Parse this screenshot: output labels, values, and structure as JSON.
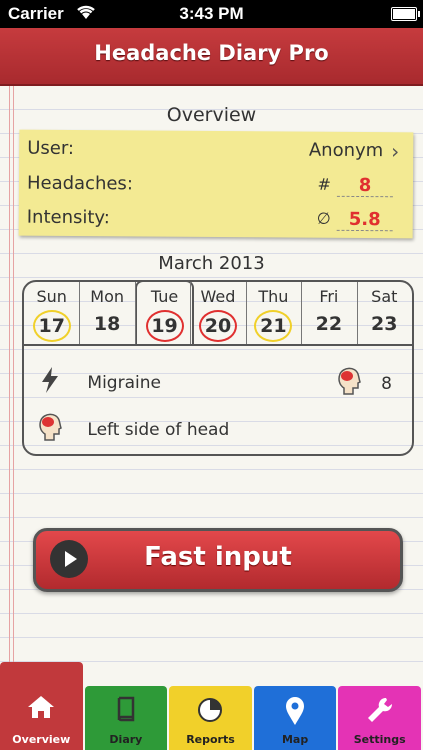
{
  "status_bar": {
    "carrier": "Carrier",
    "time": "3:43 PM"
  },
  "header": {
    "title": "Headache Diary Pro"
  },
  "overview": {
    "title": "Overview",
    "user_label": "User:",
    "user_value": "Anonym",
    "headaches_label": "Headaches:",
    "headaches_symbol": "#",
    "headaches_value": "8",
    "intensity_label": "Intensity:",
    "intensity_symbol": "∅",
    "intensity_value": "5.8"
  },
  "calendar": {
    "month": "March 2013",
    "days": [
      {
        "name": "Sun",
        "date": "17",
        "mark": "yellow"
      },
      {
        "name": "Mon",
        "date": "18",
        "mark": "none"
      },
      {
        "name": "Tue",
        "date": "19",
        "mark": "red",
        "selected": true
      },
      {
        "name": "Wed",
        "date": "20",
        "mark": "red"
      },
      {
        "name": "Thu",
        "date": "21",
        "mark": "yellow"
      },
      {
        "name": "Fri",
        "date": "22",
        "mark": "none"
      },
      {
        "name": "Sat",
        "date": "23",
        "mark": "none"
      }
    ],
    "event_type": "Migraine",
    "event_count": "8",
    "event_location": "Left side of head"
  },
  "fast_input": {
    "label": "Fast input"
  },
  "tabs": [
    {
      "label": "Overview",
      "icon": "home-icon",
      "color": "#c1393c"
    },
    {
      "label": "Diary",
      "icon": "book-icon",
      "color": "#2e9a38"
    },
    {
      "label": "Reports",
      "icon": "pie-chart-icon",
      "color": "#f1d02a"
    },
    {
      "label": "Map",
      "icon": "map-pin-icon",
      "color": "#1f6fd8"
    },
    {
      "label": "Settings",
      "icon": "wrench-icon",
      "color": "#e433b5"
    }
  ]
}
